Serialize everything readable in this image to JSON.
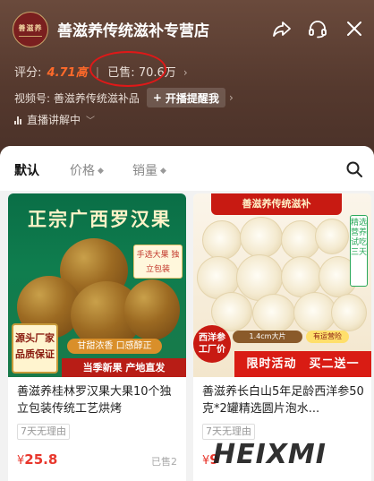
{
  "header": {
    "logo_text": "善滋养",
    "store_name": "善滋养传统滋补专营店",
    "rating_label": "评分:",
    "rating_value": "4.71高",
    "sold_label": "已售:",
    "sold_value": "70.6万",
    "video_account": "视频号: 善滋养传统滋补品",
    "remind_button": "开播提醒我",
    "live_status": "直播讲解中"
  },
  "tabs": [
    {
      "label": "默认",
      "active": true
    },
    {
      "label": "价格",
      "active": false
    },
    {
      "label": "销量",
      "active": false
    }
  ],
  "products": [
    {
      "image_texts": {
        "banner": "正宗广西罗汉果",
        "pack_tag": "手选大果 独立包装",
        "seal": "源头厂家 品质保证",
        "pill": "甘甜浓香 口感醇正",
        "bottom": "当季新果 产地直发"
      },
      "title": "善滋养桂林罗汉果大果10个独立包装传统工艺烘烤",
      "tag": "7天无理由",
      "price_symbol": "¥",
      "price": "25.8",
      "sold": "已售2"
    },
    {
      "image_texts": {
        "top": "善滋养传统滋补",
        "side": "精选营养 试吃三天",
        "size": "1.4cm大片",
        "lucky": "有运营险",
        "badge": "西洋参 工厂价",
        "bottom": "限时活动　买二送一"
      },
      "title": "善滋养长白山5年足龄西洋参50克*2罐精选圆片泡水...",
      "tag": "7天无理由",
      "price_symbol": "¥",
      "price": "9",
      "sold": ""
    }
  ],
  "watermark": "HEIXMI",
  "colors": {
    "header_bg": "#55392e",
    "accent_red": "#e8362c",
    "rating_orange": "#ff6a2a",
    "annotation_circle": "#e01818"
  }
}
